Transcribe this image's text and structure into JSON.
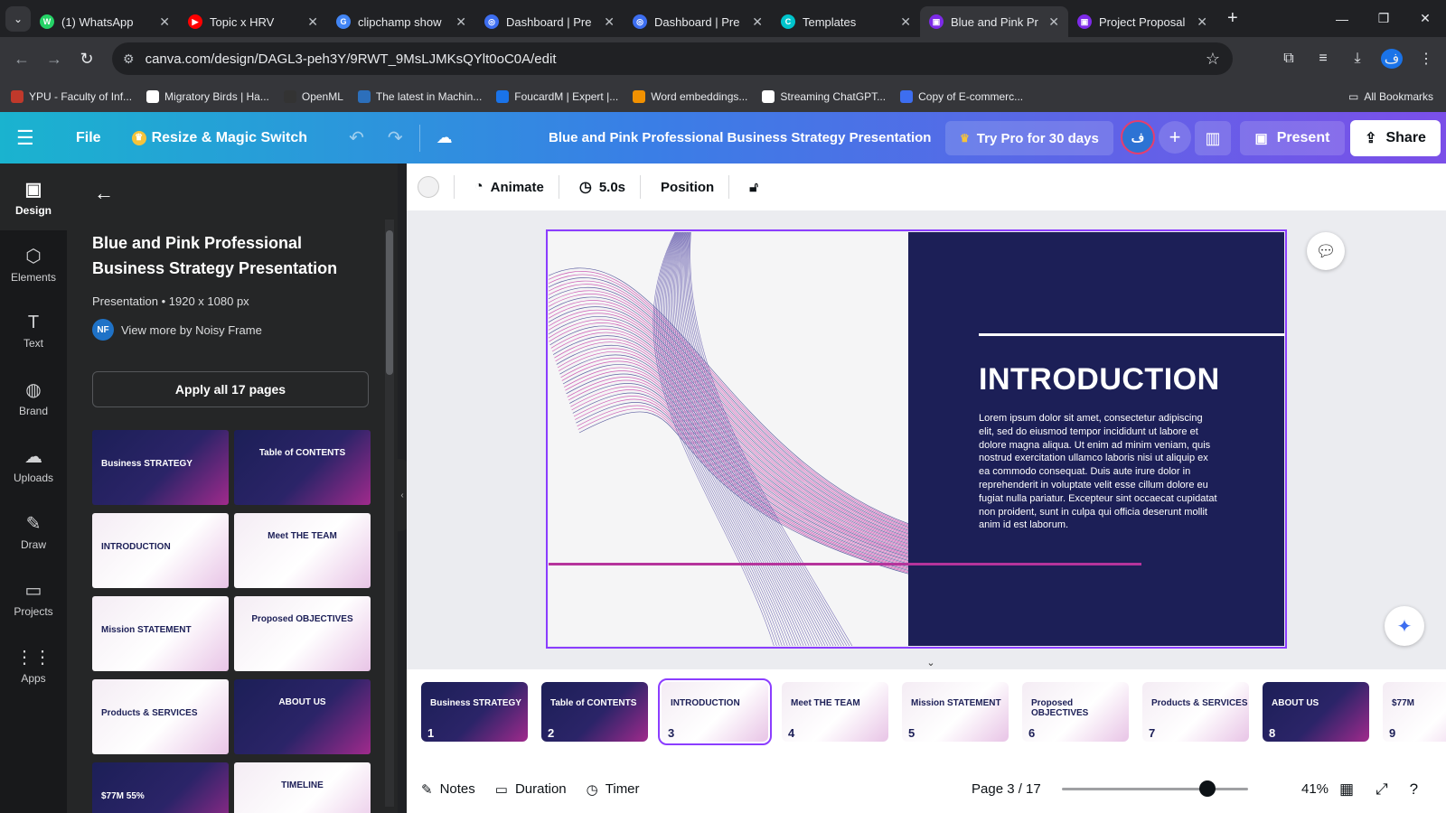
{
  "browser": {
    "tabs": [
      {
        "title": "(1) WhatsApp",
        "color": "#25d366",
        "glyph": "W"
      },
      {
        "title": "Topic x HRV",
        "color": "#ff0000",
        "glyph": "▶"
      },
      {
        "title": "clipchamp show",
        "color": "#4285f4",
        "glyph": "G"
      },
      {
        "title": "Dashboard | Pre",
        "color": "#3d6ef0",
        "glyph": "◎"
      },
      {
        "title": "Dashboard | Pre",
        "color": "#3d6ef0",
        "glyph": "◎"
      },
      {
        "title": "Templates",
        "color": "#00c4cc",
        "glyph": "C"
      },
      {
        "title": "Blue and Pink Pr",
        "color": "#7d2ae8",
        "glyph": "▣"
      },
      {
        "title": "Project Proposal",
        "color": "#7d2ae8",
        "glyph": "▣"
      }
    ],
    "url": "canva.com/design/DAGL3-peh3Y/9RWT_9MsLJMKsQYlt0oC0A/edit",
    "profile_initial": "ف",
    "bookmarks": [
      {
        "label": "YPU - Faculty of Inf...",
        "color": "#c0392b"
      },
      {
        "label": "Migratory Birds | Ha...",
        "color": "#ffffff"
      },
      {
        "label": "OpenML",
        "color": "#333333"
      },
      {
        "label": "The latest in Machin...",
        "color": "#2c6fbb"
      },
      {
        "label": "FoucardM | Expert |...",
        "color": "#1a73e8"
      },
      {
        "label": "Word embeddings...",
        "color": "#f29100"
      },
      {
        "label": "Streaming ChatGPT...",
        "color": "#ffffff"
      },
      {
        "label": "Copy of E-commerc...",
        "color": "#3d6ef0"
      }
    ],
    "all_bookmarks": "All Bookmarks"
  },
  "canva_top": {
    "file": "File",
    "resize": "Resize & Magic Switch",
    "title": "Blue and Pink Professional Business Strategy Presentation",
    "try_pro": "Try Pro for 30 days",
    "avatar": "ف",
    "present": "Present",
    "share": "Share"
  },
  "rail": [
    {
      "label": "Design",
      "icon": "▣"
    },
    {
      "label": "Elements",
      "icon": "⬡"
    },
    {
      "label": "Text",
      "icon": "T"
    },
    {
      "label": "Brand",
      "icon": "◍"
    },
    {
      "label": "Uploads",
      "icon": "☁"
    },
    {
      "label": "Draw",
      "icon": "✎"
    },
    {
      "label": "Projects",
      "icon": "▭"
    },
    {
      "label": "Apps",
      "icon": "⋮⋮"
    }
  ],
  "panel": {
    "title": "Blue and Pink Professional Business Strategy Presentation",
    "subtitle": "Presentation • 1920 x 1080 px",
    "author_initials": "NF",
    "author": "View more by Noisy Frame",
    "apply": "Apply all 17 pages",
    "thumbs": [
      {
        "text": "Business STRATEGY",
        "style": "dark"
      },
      {
        "text": "Table of CONTENTS",
        "style": "dark"
      },
      {
        "text": "INTRODUCTION",
        "style": "light"
      },
      {
        "text": "Meet THE TEAM",
        "style": "light"
      },
      {
        "text": "Mission STATEMENT",
        "style": "light"
      },
      {
        "text": "Proposed OBJECTIVES",
        "style": "light"
      },
      {
        "text": "Products & SERVICES",
        "style": "light"
      },
      {
        "text": "ABOUT US",
        "style": "dark"
      },
      {
        "text": "$77M 55%",
        "style": "dark"
      },
      {
        "text": "TIMELINE",
        "style": "light"
      }
    ]
  },
  "toolbar": {
    "animate": "Animate",
    "duration": "5.0s",
    "position": "Position"
  },
  "slide": {
    "heading": "INTRODUCTION",
    "body": "Lorem ipsum dolor sit amet, consectetur adipiscing elit, sed do eiusmod tempor incididunt ut labore et dolore magna aliqua. Ut enim ad minim veniam, quis nostrud exercitation ullamco laboris nisi ut aliquip ex ea commodo consequat. Duis aute irure dolor in reprehenderit in voluptate velit esse cillum dolore eu fugiat nulla pariatur. Excepteur sint occaecat cupidatat non proident, sunt in culpa qui officia deserunt mollit anim id est laborum.",
    "navy": "#1c1f57",
    "pink": "#b5349c"
  },
  "filmstrip": [
    {
      "num": "1",
      "label": "Business STRATEGY",
      "style": "dark"
    },
    {
      "num": "2",
      "label": "Table of CONTENTS",
      "style": "dark"
    },
    {
      "num": "3",
      "label": "INTRODUCTION",
      "style": "light",
      "selected": true
    },
    {
      "num": "4",
      "label": "Meet THE TEAM",
      "style": "light"
    },
    {
      "num": "5",
      "label": "Mission STATEMENT",
      "style": "light"
    },
    {
      "num": "6",
      "label": "Proposed OBJECTIVES",
      "style": "light"
    },
    {
      "num": "7",
      "label": "Products & SERVICES",
      "style": "light"
    },
    {
      "num": "8",
      "label": "ABOUT US",
      "style": "dark"
    },
    {
      "num": "9",
      "label": "$77M",
      "style": "light"
    }
  ],
  "bottom": {
    "notes": "Notes",
    "duration": "Duration",
    "timer": "Timer",
    "page": "Page 3 / 17",
    "zoom": "41%",
    "zoom_level_fraction": 0.41
  }
}
